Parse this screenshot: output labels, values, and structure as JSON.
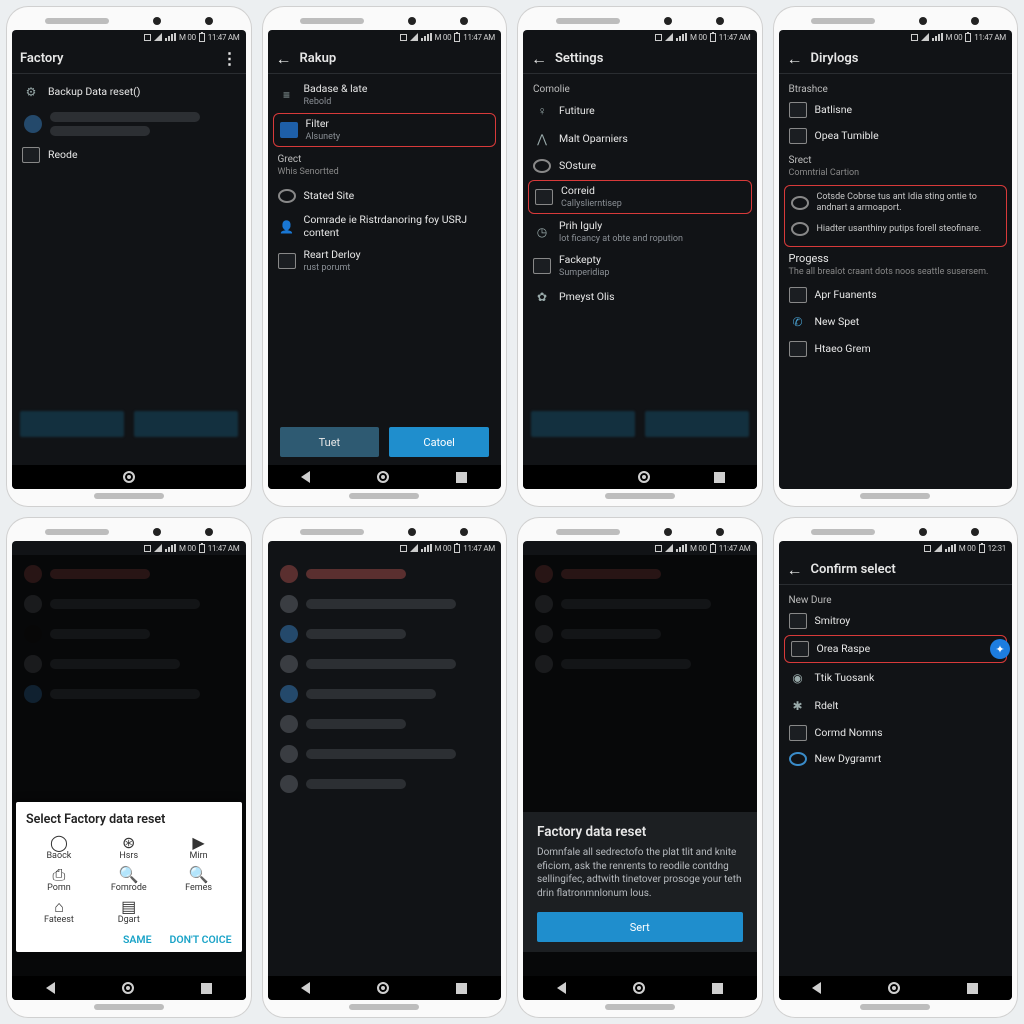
{
  "status": {
    "time": "11:47 AM",
    "clock2": "12:31",
    "carrier": "M 00"
  },
  "nav": {
    "back": "◀",
    "home": "●",
    "recent": "■"
  },
  "phone1": {
    "title": "Factory",
    "row1": "Backup Data reset()",
    "row2": "Reode"
  },
  "phone2": {
    "title": "Rakup",
    "sec1a": "Badase & late",
    "sec1b": "Rebold",
    "hl_t": "Filter",
    "hl_s": "Alsunety",
    "sec2": "Grect",
    "sec2s": "Whis Senortted",
    "r1": "Stated Site",
    "r2": "Comrade ie Ristrdanoring foy USRJ content",
    "r3": "Reart Derloy",
    "r3s": "rust porumt",
    "btn_left": "Tuet",
    "btn_right": "Catoel"
  },
  "phone3": {
    "title": "Settings",
    "sec": "Comolie",
    "r1": "Futiture",
    "r2": "Malt Oparniers",
    "r3": "SOsture",
    "hl_t": "Correid",
    "hl_s": "Callyslierntisep",
    "r4": "Prih Iguly",
    "r4s": "lot ficancy at obte and ropution",
    "r5": "Fackepty",
    "r5s": "Sumperidiap",
    "r6": "Pmeyst Olis"
  },
  "phone4": {
    "title": "Dirylogs",
    "sec": "Btrashce",
    "r1": "Batlisne",
    "r2": "Opea Tumible",
    "sec2": "Srect",
    "sec2s": "Comntrial Cartion",
    "hl1": "Cotsde Cobrse tus ant Idia sting ontie to andnart a armoaport.",
    "hl2": "Hiadter usanthiny putips forell steofinare.",
    "prog": "Progess",
    "progsub": "The all brealot craant dots noos seattle susersem.",
    "r3": "Apr Fuanents",
    "r4": "New Spet",
    "r5": "Htaeo Grem"
  },
  "phone5": {
    "sheet_title": "Select Factory data reset",
    "cells": [
      {
        "i": "◯",
        "l": "Baock"
      },
      {
        "i": "⊛",
        "l": "Hsrs"
      },
      {
        "i": "▶",
        "l": "Mirn"
      },
      {
        "i": "⎙",
        "l": "Pomn"
      },
      {
        "i": "🔍",
        "l": "Fomrode"
      },
      {
        "i": "🔍",
        "l": "Femes"
      },
      {
        "i": "⌂",
        "l": "Fateest"
      },
      {
        "i": "▤",
        "l": "Dgart"
      }
    ],
    "act1": "SAME",
    "act2": "DON'T COICE"
  },
  "phone7": {
    "title": "Factory data reset",
    "body": "Domnfale all sedrectofo the plat tlit and knite eficiom, ask the renrents to reodile contdng sellingifec, adtwith tinetover prosoge your teth drin flatronmnlonum lous.",
    "btn": "Sert"
  },
  "phone8": {
    "title": "Confirm select",
    "sec": "New Dure",
    "r1": "Smitroy",
    "hl": "Orea Raspe",
    "r2": "Ttik Tuosank",
    "r3": "Rdelt",
    "r4": "Cormd Nomns",
    "r5": "New Dygramrt"
  }
}
